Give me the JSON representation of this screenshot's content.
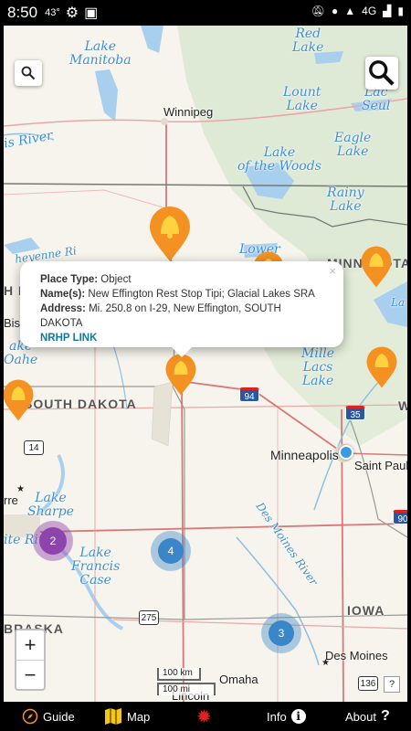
{
  "status_bar": {
    "time": "8:50",
    "temperature": "43°",
    "network": "4G"
  },
  "map": {
    "lakes": [
      {
        "name": "Red\nLake"
      },
      {
        "name": "Lake\nManitoba"
      },
      {
        "name": "Lac\nSeul"
      },
      {
        "name": "Lount\nLake"
      },
      {
        "name": "Eagle\nLake"
      },
      {
        "name": "Lake\nof the Woods"
      },
      {
        "name": "Rainy\nLake"
      },
      {
        "name": "Lower\nRed"
      },
      {
        "name": "Mille\nLacs\nLake"
      },
      {
        "name": "Lake\nSharpe"
      },
      {
        "name": "Lake\nFrancis\nCase"
      },
      {
        "name": "Lake\nVermilion"
      }
    ],
    "river_labels": [
      "Red River",
      "Des Moines River",
      "White River",
      "Cheyenne River"
    ],
    "cities": [
      "Winnipeg",
      "Minneapolis",
      "Saint Paul",
      "Des Moines",
      "Omaha",
      "Lincoln",
      "Bismarck",
      "Pierre"
    ],
    "states": [
      "SOUTH DAKOTA",
      "MINNESOTA",
      "IOWA",
      "NEBRASKA",
      "NORTH DAKOTA"
    ],
    "highways": [
      "94",
      "35",
      "14",
      "275",
      "90",
      "136"
    ],
    "clusters": [
      {
        "count": "2",
        "color": "#8e44ad"
      },
      {
        "count": "4",
        "color": "#3a86c8"
      },
      {
        "count": "3",
        "color": "#3a86c8"
      }
    ],
    "scale_km": "100 km",
    "scale_mi": "100 mi",
    "help": "?",
    "zoom_in": "+",
    "zoom_out": "−"
  },
  "popup": {
    "place_type_label": "Place Type:",
    "place_type": "Object",
    "names_label": "Name(s):",
    "names": "New Effington Rest Stop Tipi; Glacial Lakes SRA",
    "address_label": "Address:",
    "address": "Mi. 250.8 on I-29, New Effington, SOUTH DAKOTA",
    "link": "NRHP LINK",
    "close": "×"
  },
  "nav": {
    "guide": "Guide",
    "map": "Map",
    "info": "Info",
    "about": "About"
  },
  "colors": {
    "pin": "#f39223",
    "cluster_blue": "#3a86c8",
    "cluster_purple": "#8e44ad",
    "link": "#0d7ba0"
  }
}
